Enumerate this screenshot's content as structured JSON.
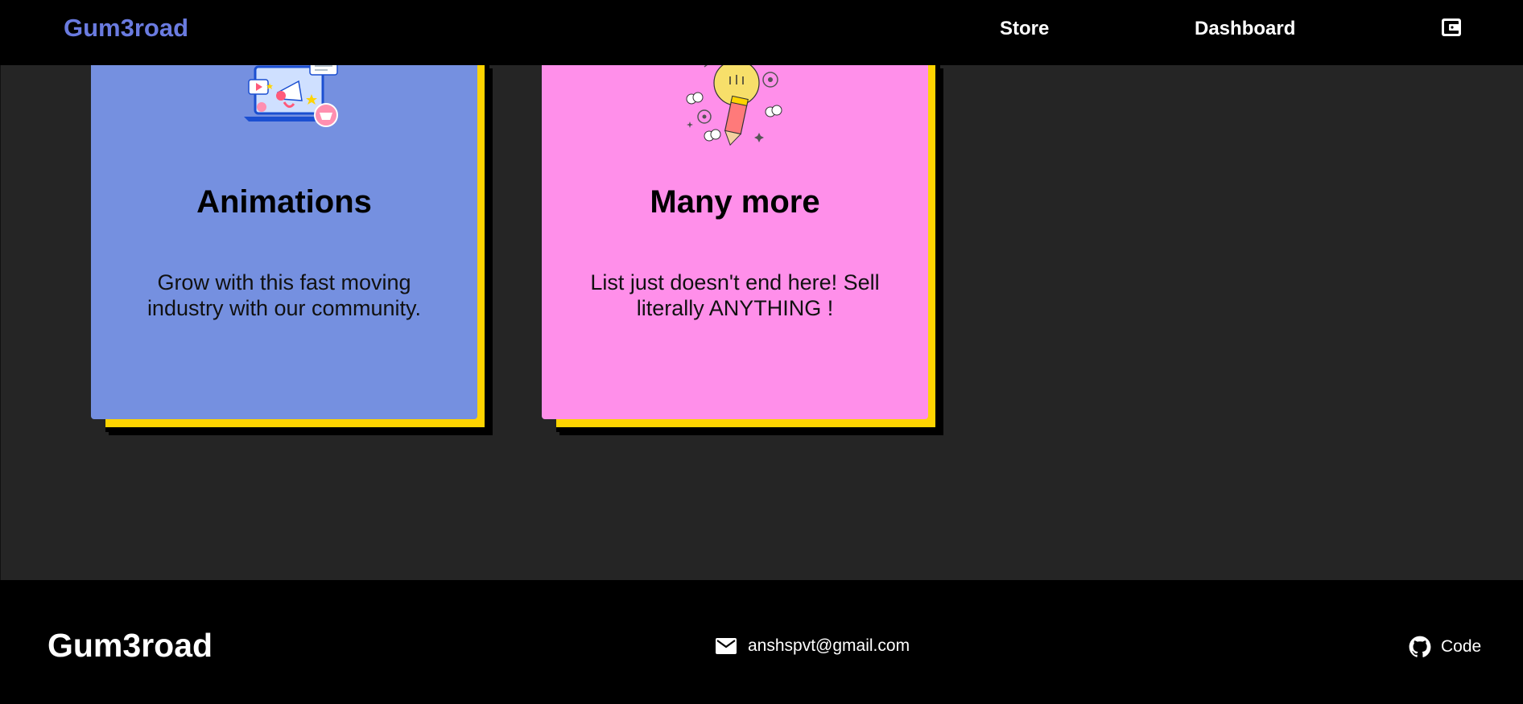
{
  "nav": {
    "brand": "Gum3road",
    "links": [
      {
        "label": "Store"
      },
      {
        "label": "Dashboard"
      }
    ],
    "wallet_icon": "wallet-icon",
    "brand_color": "#6a7be0"
  },
  "cards": [
    {
      "title": "Animations",
      "description": "Grow with this fast moving industry with our community.",
      "illustration": "laptop-megaphone-illustration",
      "color": "#7590e0"
    },
    {
      "title": "Many more",
      "description": "List just doesn't end here! Sell literally ANYTHING !",
      "illustration": "lightbulb-pencil-illustration",
      "color": "#ff8fea"
    }
  ],
  "card_shadow_color": "#ffd400",
  "footer": {
    "brand": "Gum3road",
    "email": "anshspvt@gmail.com",
    "email_icon": "mail-icon",
    "code_label": "Code",
    "code_icon": "github-icon"
  }
}
